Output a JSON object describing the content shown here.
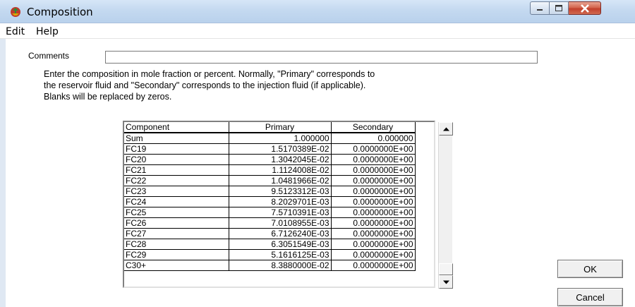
{
  "window": {
    "title": "Composition",
    "icon": "composition-app-icon"
  },
  "menu": {
    "items": [
      "Edit",
      "Help"
    ]
  },
  "form": {
    "comments_label": "Comments",
    "comments_value": "",
    "instructions": [
      "Enter the composition in mole fraction or percent.  Normally, \"Primary\" corresponds to",
      "the reservoir fluid and \"Secondary\" corresponds to the injection fluid (if applicable).",
      "Blanks will be replaced by zeros."
    ]
  },
  "table": {
    "headers": [
      "Component",
      "Primary",
      "Secondary"
    ],
    "rows": [
      [
        "Sum",
        "1.000000",
        "0.000000"
      ],
      [
        "FC19",
        "1.5170389E-02",
        "0.0000000E+00"
      ],
      [
        "FC20",
        "1.3042045E-02",
        "0.0000000E+00"
      ],
      [
        "FC21",
        "1.1124008E-02",
        "0.0000000E+00"
      ],
      [
        "FC22",
        "1.0481966E-02",
        "0.0000000E+00"
      ],
      [
        "FC23",
        "9.5123312E-03",
        "0.0000000E+00"
      ],
      [
        "FC24",
        "8.2029701E-03",
        "0.0000000E+00"
      ],
      [
        "FC25",
        "7.5710391E-03",
        "0.0000000E+00"
      ],
      [
        "FC26",
        "7.0108955E-03",
        "0.0000000E+00"
      ],
      [
        "FC27",
        "6.7126240E-03",
        "0.0000000E+00"
      ],
      [
        "FC28",
        "6.3051549E-03",
        "0.0000000E+00"
      ],
      [
        "FC29",
        "5.1616125E-03",
        "0.0000000E+00"
      ],
      [
        "C30+",
        "8.3880000E-02",
        "0.0000000E+00"
      ]
    ]
  },
  "buttons": {
    "ok": "OK",
    "cancel": "Cancel"
  }
}
